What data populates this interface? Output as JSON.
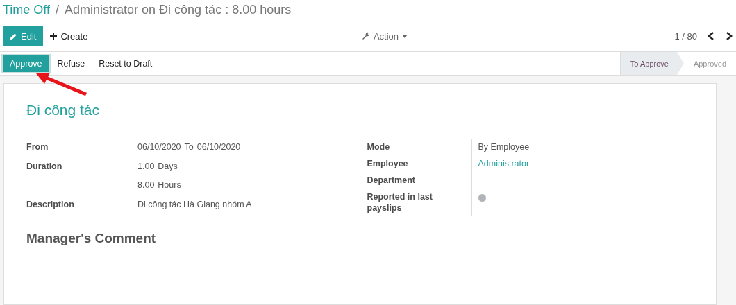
{
  "breadcrumb": {
    "parent": "Time Off",
    "separator": "/",
    "current": "Administrator on Đi công tác : 8.00 hours"
  },
  "toolbar": {
    "edit": "Edit",
    "create": "Create",
    "action": "Action",
    "pager": "1 / 80"
  },
  "actions": [
    {
      "label": "Approve",
      "primary": true
    },
    {
      "label": "Refuse",
      "primary": false
    },
    {
      "label": "Reset to Draft",
      "primary": false
    }
  ],
  "stages": [
    {
      "label": "To Approve",
      "selected": true
    },
    {
      "label": "Approved",
      "selected": false
    }
  ],
  "sheet": {
    "title": "Đi công tác",
    "left_fields": [
      {
        "label": "From",
        "parts": [
          "06/10/2020",
          "To",
          "06/10/2020"
        ]
      },
      {
        "label": "Duration",
        "parts": [
          "1.00",
          "Days"
        ]
      },
      {
        "parts": [
          "8.00",
          "Hours"
        ]
      },
      {
        "label": "Description",
        "parts": [
          "Đi công tác Hà Giang nhóm A"
        ]
      }
    ],
    "right_fields": [
      {
        "label": "Mode",
        "kind": "text",
        "value": "By Employee"
      },
      {
        "label": "Employee",
        "kind": "link",
        "value": "Administrator"
      },
      {
        "label": "Department",
        "kind": "empty"
      },
      {
        "label": "Reported in last payslips",
        "kind": "dot",
        "on": false
      }
    ],
    "comment_heading": "Manager's Comment"
  }
}
